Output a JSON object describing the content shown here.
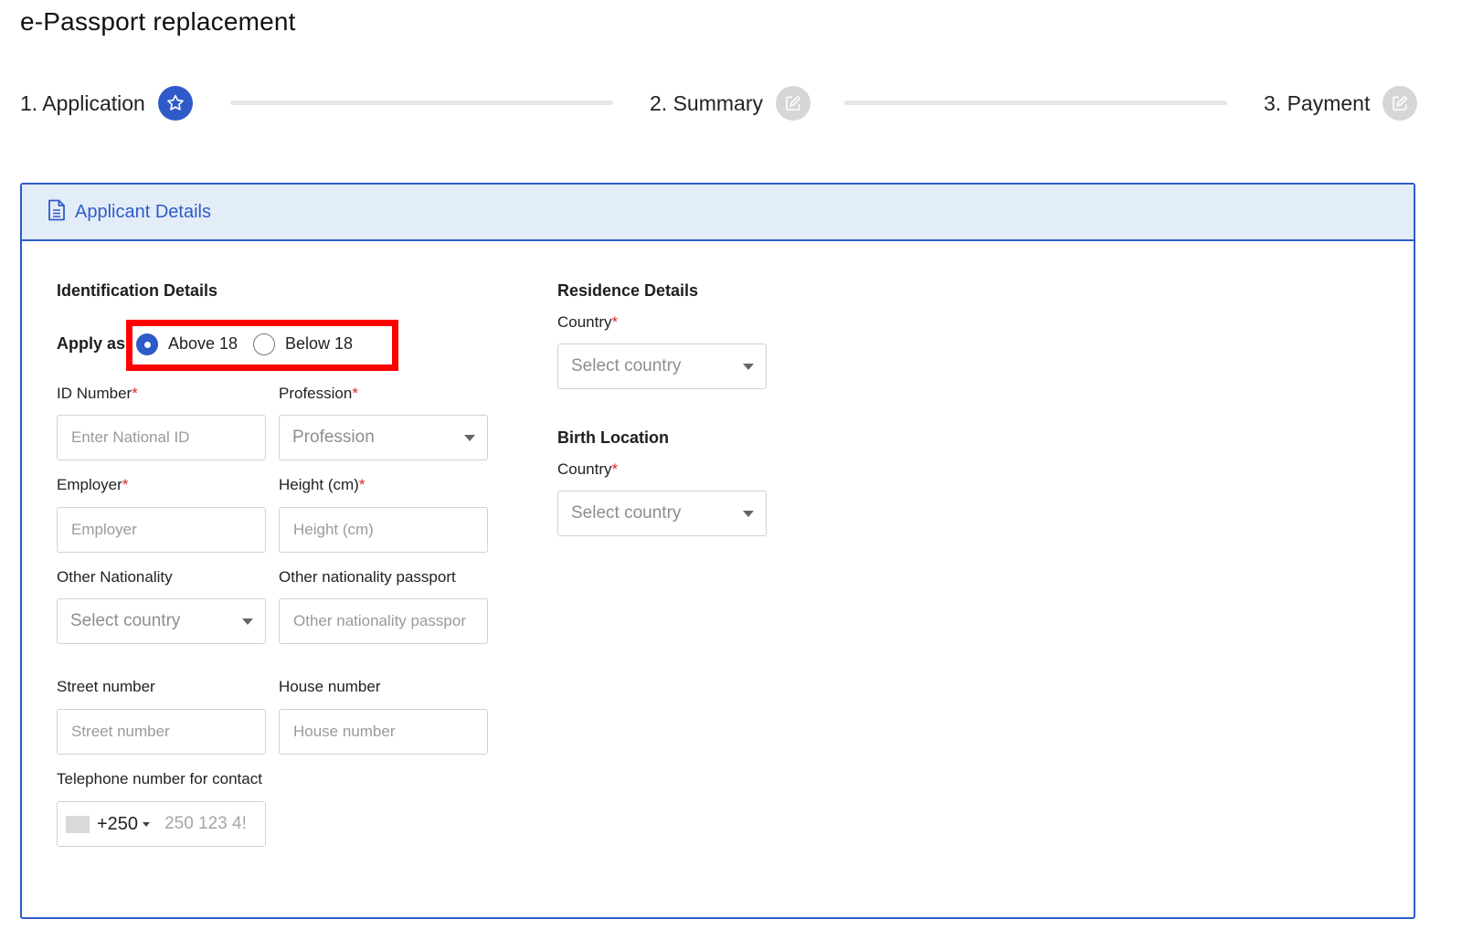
{
  "page": {
    "title": "e-Passport replacement"
  },
  "stepper": {
    "steps": [
      {
        "label": "1. Application",
        "icon": "star-icon",
        "state": "active"
      },
      {
        "label": "2. Summary",
        "icon": "edit-icon",
        "state": "inactive"
      },
      {
        "label": "3. Payment",
        "icon": "edit-icon",
        "state": "inactive"
      }
    ]
  },
  "card": {
    "title": "Applicant Details",
    "icon": "document-icon"
  },
  "identification": {
    "title": "Identification Details",
    "apply_as": {
      "label": "Apply as",
      "options": [
        {
          "label": "Above 18",
          "checked": true
        },
        {
          "label": "Below 18",
          "checked": false
        }
      ]
    },
    "fields": {
      "id_number": {
        "label": "ID Number",
        "required_mark": "*",
        "placeholder": "Enter National ID"
      },
      "profession": {
        "label": "Profession",
        "required_mark": "*",
        "placeholder": "Profession"
      },
      "employer": {
        "label": "Employer",
        "required_mark": "*",
        "placeholder": "Employer"
      },
      "height": {
        "label": "Height (cm)",
        "required_mark": "*",
        "placeholder": "Height (cm)"
      },
      "other_nationality": {
        "label": "Other Nationality",
        "placeholder": "Select country"
      },
      "other_nationality_passport": {
        "label": "Other nationality passport",
        "placeholder": "Other nationality passpor"
      },
      "street_number": {
        "label": "Street number",
        "placeholder": "Street number"
      },
      "house_number": {
        "label": "House number",
        "placeholder": "House number"
      },
      "telephone": {
        "label": "Telephone number for contact",
        "dial_code": "+250",
        "placeholder": "250 123 4!"
      }
    }
  },
  "residence": {
    "title": "Residence Details",
    "country": {
      "label": "Country",
      "required_mark": "*",
      "placeholder": "Select country"
    }
  },
  "birth_location": {
    "title": "Birth Location",
    "country": {
      "label": "Country",
      "required_mark": "*",
      "placeholder": "Select country"
    }
  },
  "colors": {
    "accent": "#2f5bc9",
    "header_bg": "#e3edf8",
    "highlight": "#ff0000",
    "required": "#e02424"
  }
}
